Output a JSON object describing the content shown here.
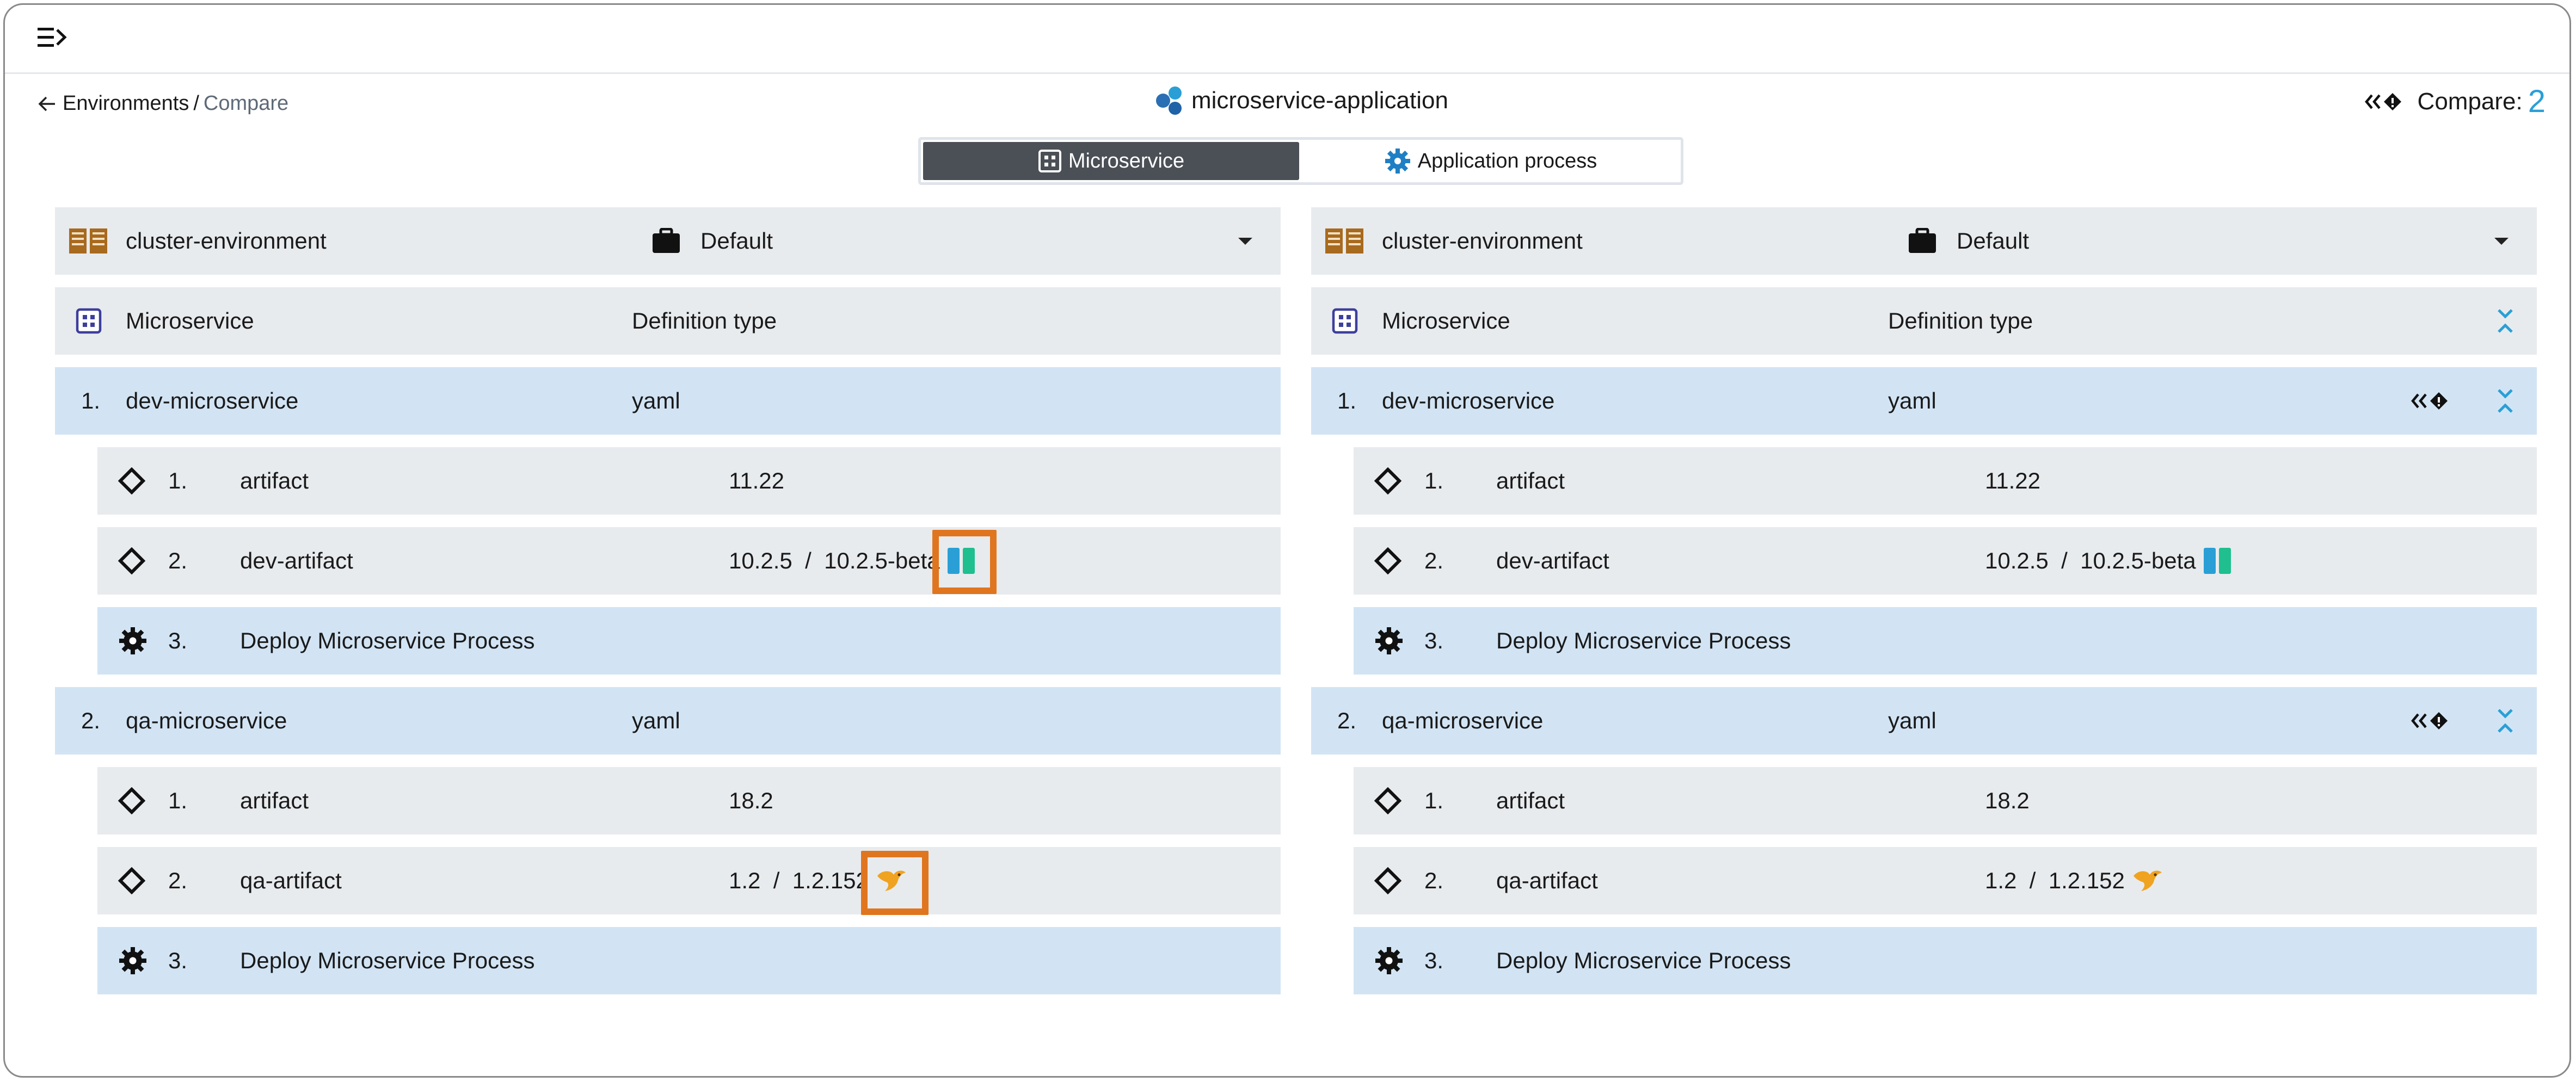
{
  "header": {
    "breadcrumb_root": "Environments",
    "breadcrumb_separator": "/",
    "breadcrumb_current": "Compare",
    "app_title": "microservice-application",
    "compare_label": "Compare:",
    "compare_count": "2"
  },
  "toggle": {
    "microservice_label": "Microservice",
    "process_label": "Application process",
    "active": "Microservice"
  },
  "panels": [
    {
      "environment": "cluster-environment",
      "snapshot": "Default",
      "col_microservice": "Microservice",
      "col_definition": "Definition type",
      "microservices": [
        {
          "index": "1.",
          "name": "dev-microservice",
          "type": "yaml",
          "items": [
            {
              "index": "1.",
              "name": "artifact",
              "value": "11.22",
              "kind": "artifact"
            },
            {
              "index": "2.",
              "name": "dev-artifact",
              "value": "10.2.5  /  10.2.5-beta",
              "kind": "artifact",
              "badge": "nexus-icon"
            },
            {
              "index": "3.",
              "name": "Deploy Microservice Process",
              "value": "",
              "kind": "process"
            }
          ]
        },
        {
          "index": "2.",
          "name": "qa-microservice",
          "type": "yaml",
          "items": [
            {
              "index": "1.",
              "name": "artifact",
              "value": "18.2",
              "kind": "artifact"
            },
            {
              "index": "2.",
              "name": "qa-artifact",
              "value": "1.2  /  1.2.152",
              "kind": "artifact",
              "badge": "jenkins-bird-icon"
            },
            {
              "index": "3.",
              "name": "Deploy Microservice Process",
              "value": "",
              "kind": "process"
            }
          ]
        }
      ]
    },
    {
      "environment": "cluster-environment",
      "snapshot": "Default",
      "col_microservice": "Microservice",
      "col_definition": "Definition type",
      "microservices": [
        {
          "index": "1.",
          "name": "dev-microservice",
          "type": "yaml",
          "items": [
            {
              "index": "1.",
              "name": "artifact",
              "value": "11.22",
              "kind": "artifact"
            },
            {
              "index": "2.",
              "name": "dev-artifact",
              "value": "10.2.5  /  10.2.5-beta",
              "kind": "artifact",
              "badge": "nexus-icon"
            },
            {
              "index": "3.",
              "name": "Deploy Microservice Process",
              "value": "",
              "kind": "process"
            }
          ]
        },
        {
          "index": "2.",
          "name": "qa-microservice",
          "type": "yaml",
          "items": [
            {
              "index": "1.",
              "name": "artifact",
              "value": "18.2",
              "kind": "artifact"
            },
            {
              "index": "2.",
              "name": "qa-artifact",
              "value": "1.2  /  1.2.152",
              "kind": "artifact",
              "badge": "jenkins-bird-icon"
            },
            {
              "index": "3.",
              "name": "Deploy Microservice Process",
              "value": "",
              "kind": "process"
            }
          ]
        }
      ]
    }
  ],
  "colors": {
    "accent": "#2a9fd6",
    "highlight": "#e0751f",
    "row_grey": "#e8ebee",
    "row_blue": "#d2e4f4",
    "active_tab": "#4b5056"
  }
}
